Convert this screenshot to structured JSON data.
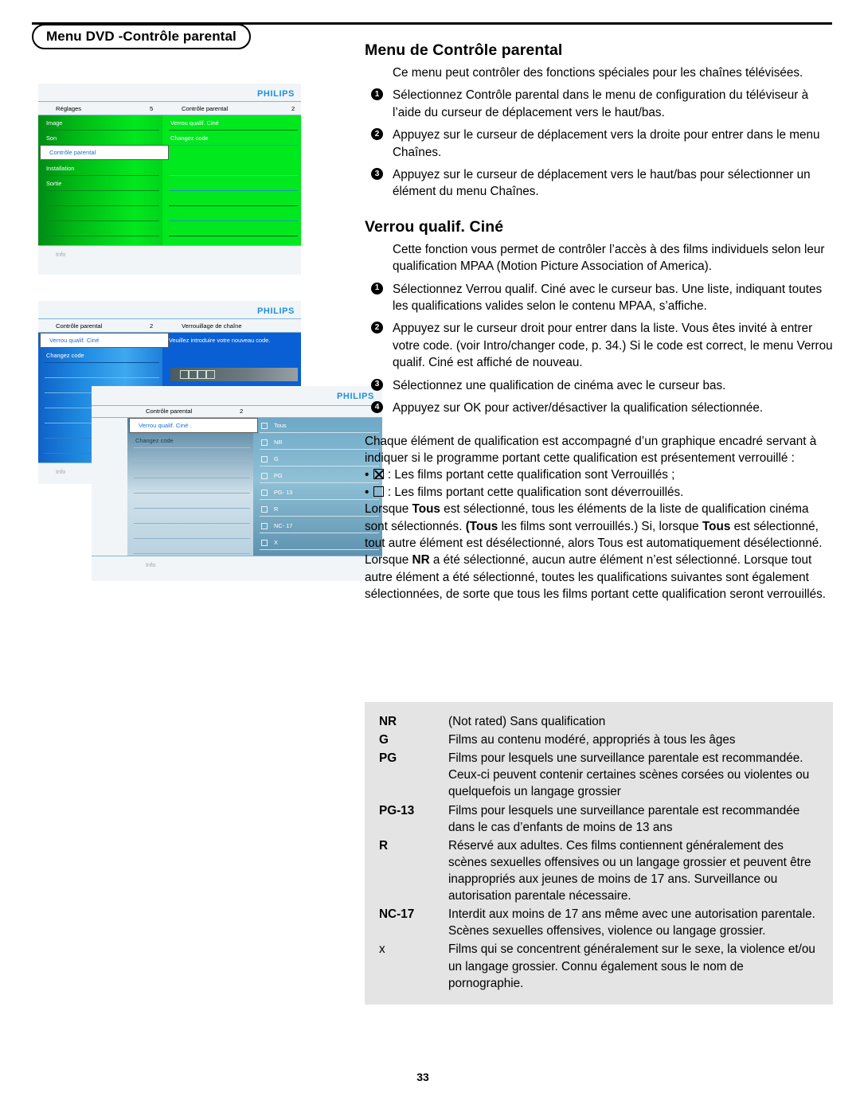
{
  "header": {
    "tab_label": "Menu DVD -Contrôle parental"
  },
  "page_number": "33",
  "sections": [
    {
      "title": "Menu de Contrôle parental",
      "intro": "Ce menu peut contrôler des fonctions spéciales pour les chaînes télévisées.",
      "steps": [
        "Sélectionnez Contrôle parental dans le menu de configuration du téléviseur à l’aide du curseur de déplacement vers le haut/bas.",
        "Appuyez sur le curseur de déplacement vers la droite pour entrer dans le menu Chaînes.",
        "Appuyez sur le curseur de déplacement vers le haut/bas pour sélectionner un élément du menu Chaînes."
      ]
    },
    {
      "title": "Verrou qualif. Ciné",
      "intro": "Cette fonction vous permet de contrôler l’accès à des films individuels selon leur qualification MPAA (Motion Picture Association of America).",
      "steps": [
        "Sélectionnez Verrou qualif. Ciné avec le curseur bas. Une liste, indiquant toutes les qualifications valides selon le contenu MPAA, s’affiche.",
        "Appuyez sur le curseur droit pour entrer dans la liste. Vous êtes invité à entrer votre code. (voir Intro/changer code, p. 34.) Si le code est correct, le menu Verrou qualif. Ciné est affiché de nouveau.",
        "Sélectionnez une qualification de cinéma avec le curseur bas.",
        "Appuyez sur OK pour activer/désactiver la qualification sélectionnée."
      ]
    }
  ],
  "body": {
    "p1": "Chaque élément de qualification est accompagné d’un graphique encadré servant à indiquer si le programme portant cette qualification est présentement verrouillé :",
    "bullet_locked": ": Les films portant cette qualification sont Verrouillés ;",
    "bullet_unlocked": ": Les films portant cette qualification sont déverrouillés.",
    "p2_a": "Lorsque ",
    "p2_tous1": "Tous",
    "p2_b": " est sélectionné, tous les éléments de la liste de qualification cinéma sont sélectionnés. ",
    "p2_tous2": "(Tous",
    "p2_c": " les films sont verrouillés.) Si, lorsque ",
    "p2_tous3": "Tous",
    "p2_d": " est sélectionné, tout autre élément est désélectionné, alors Tous est automatiquement désélectionné.",
    "p3_a": "Lorsque ",
    "p3_nr": "NR",
    "p3_b": " a été sélectionné, aucun autre élément n’est sélectionné. Lorsque tout autre élément a été sélectionné, toutes les qualifications suivantes sont également sélectionnées, de sorte que tous les films portant cette qualification seront verrouillés."
  },
  "ratings": [
    {
      "code": "NR",
      "desc": "(Not rated) Sans qualification",
      "bold": true
    },
    {
      "code": "G",
      "desc": "Films au contenu modéré, appropriés à tous les âges",
      "bold": true
    },
    {
      "code": "PG",
      "desc": "Films pour lesquels une surveillance parentale est recommandée. Ceux-ci peuvent contenir certaines scènes corsées ou violentes ou quelquefois un langage grossier",
      "bold": true
    },
    {
      "code": "PG-13",
      "desc": "Films pour lesquels une surveillance parentale est recommandée dans le cas d’enfants de moins de 13 ans",
      "bold": true
    },
    {
      "code": "R",
      "desc": "Réservé aux adultes. Ces films contiennent généralement des scènes sexuelles offensives ou un langage grossier et peuvent être inappropriés aux jeunes de moins de 17 ans. Surveillance ou autorisation parentale nécessaire.",
      "bold": true
    },
    {
      "code": "NC-17",
      "desc": "Interdit aux moins de 17 ans même avec une autorisation parentale. Scènes sexuelles offensives, violence ou langage grossier.",
      "bold": true
    },
    {
      "code": "x",
      "desc": "Films qui se concentrent généralement sur le sexe, la violence et/ou un langage grossier. Connu également sous le nom de pornographie.",
      "bold": false
    }
  ],
  "osd": {
    "brand": "PHILIPS",
    "info_label": "Info",
    "screen1": {
      "left_title": "Réglages",
      "left_num": "5",
      "right_title": "Contrôle parental",
      "right_num": "2",
      "left_items": [
        "Image",
        "Son",
        "Contrôle parental",
        "Installation",
        "Sortie"
      ],
      "selected_item": "Contrôle parental",
      "right_items": [
        "Verrou qualif. Ciné",
        "Changez code"
      ]
    },
    "screen2": {
      "left_title": "Contrôle parental",
      "left_num": "2",
      "right_title": "Verrouillage de chaîne",
      "selected_item": "Verrou qualif. Ciné",
      "left_items": [
        "Changez code"
      ],
      "prompt": "Veuillez introduire votre nouveau code."
    },
    "screen3": {
      "left_title": "Contrôle parental",
      "left_num": "2",
      "selected_item": "Verrou qualif. Ciné .",
      "left_items": [
        "Changez code"
      ],
      "ratings_list": [
        "Tous",
        "NR",
        "G",
        "PG",
        "PG- 13",
        "R",
        "NC- 17",
        "X"
      ]
    }
  }
}
